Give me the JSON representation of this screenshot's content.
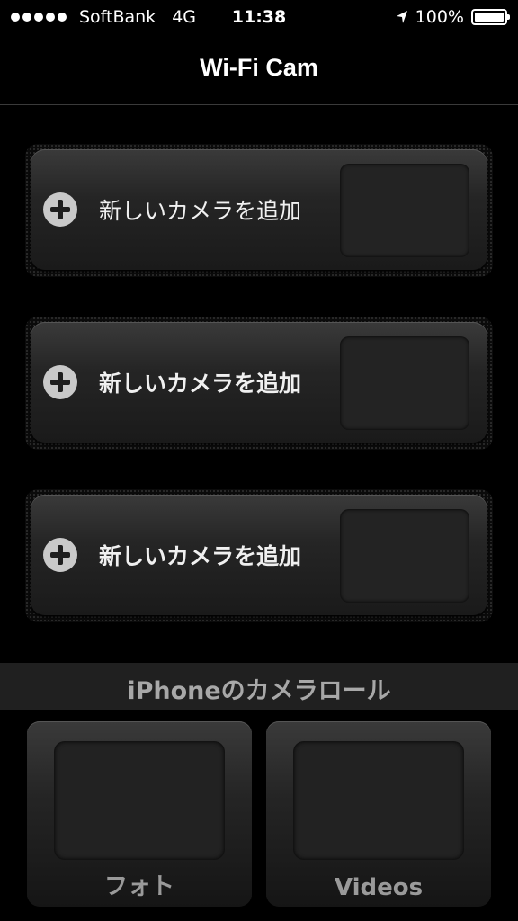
{
  "status": {
    "carrier": "SoftBank",
    "network": "4G",
    "time": "11:38",
    "battery": "100%",
    "location_icon": "location-arrow-icon",
    "battery_icon": "battery-icon",
    "signal_icon": "signal-dots-icon"
  },
  "nav": {
    "title": "Wi-Fi Cam"
  },
  "cameras": [
    {
      "label": "新しいカメラを追加",
      "icon": "plus-icon"
    },
    {
      "label": "新しいカメラを追加",
      "icon": "plus-icon"
    },
    {
      "label": "新しいカメラを追加",
      "icon": "plus-icon"
    }
  ],
  "camera_roll": {
    "header": "iPhoneのカメラロール",
    "photos_label": "フォト",
    "videos_label": "Videos"
  }
}
